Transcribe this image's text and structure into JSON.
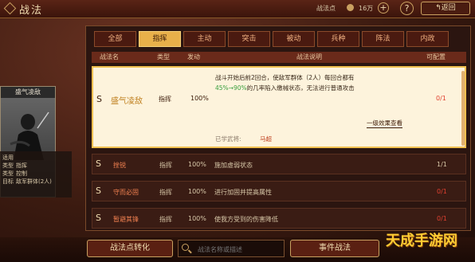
{
  "header": {
    "title": "战法",
    "points_label": "战法点",
    "points_value": "16万",
    "plus": "+",
    "help": "?",
    "back_label": "↰返回"
  },
  "tabs": [
    {
      "label": "全部",
      "active": false
    },
    {
      "label": "指挥",
      "active": true
    },
    {
      "label": "主动",
      "active": false
    },
    {
      "label": "突击",
      "active": false
    },
    {
      "label": "被动",
      "active": false
    },
    {
      "label": "兵种",
      "active": false
    },
    {
      "label": "阵法",
      "active": false
    },
    {
      "label": "内政",
      "active": false
    }
  ],
  "columns": {
    "name": "战法名",
    "type": "类型",
    "rate": "发动",
    "desc": "战法说明",
    "config": "可配置"
  },
  "hero": {
    "name": "盛气凌敌",
    "stats": [
      {
        "label": "适用",
        "value": ""
      },
      {
        "label": "类型",
        "value": "指挥"
      },
      {
        "label": "类型",
        "value": "控制"
      },
      {
        "label": "目标",
        "value": "敌军群体(2人)"
      }
    ]
  },
  "selected": {
    "grade": "S",
    "name": "盛气凌敌",
    "type": "指挥",
    "rate": "100%",
    "desc_line1": "战斗开始后前2回合，使敌军群体（2人）每回合都有",
    "desc_line2_hl": "45%→90%",
    "desc_line2": "的几率陷入缴械状态，无法进行普通攻击",
    "config": "0/1",
    "upgrade_link": "一级效果查看",
    "learned_label": "已学武将:",
    "learned_hero": "马超"
  },
  "rows": [
    {
      "grade": "S",
      "name": "挫锐",
      "type": "指挥",
      "rate": "100%",
      "desc": "施加虚弱状态",
      "config": "1/1"
    },
    {
      "grade": "S",
      "name": "守而必固",
      "type": "指挥",
      "rate": "100%",
      "desc": "进行加固并提高属性",
      "config": "0/1"
    },
    {
      "grade": "S",
      "name": "暂避其锋",
      "type": "指挥",
      "rate": "100%",
      "desc": "使我方受到的伤害降低",
      "config": "0/1"
    }
  ],
  "footer": {
    "convert_label": "战法点转化",
    "search_placeholder": "战法名称或描述",
    "event_label": "事件战法"
  },
  "watermark": "天成手游网"
}
